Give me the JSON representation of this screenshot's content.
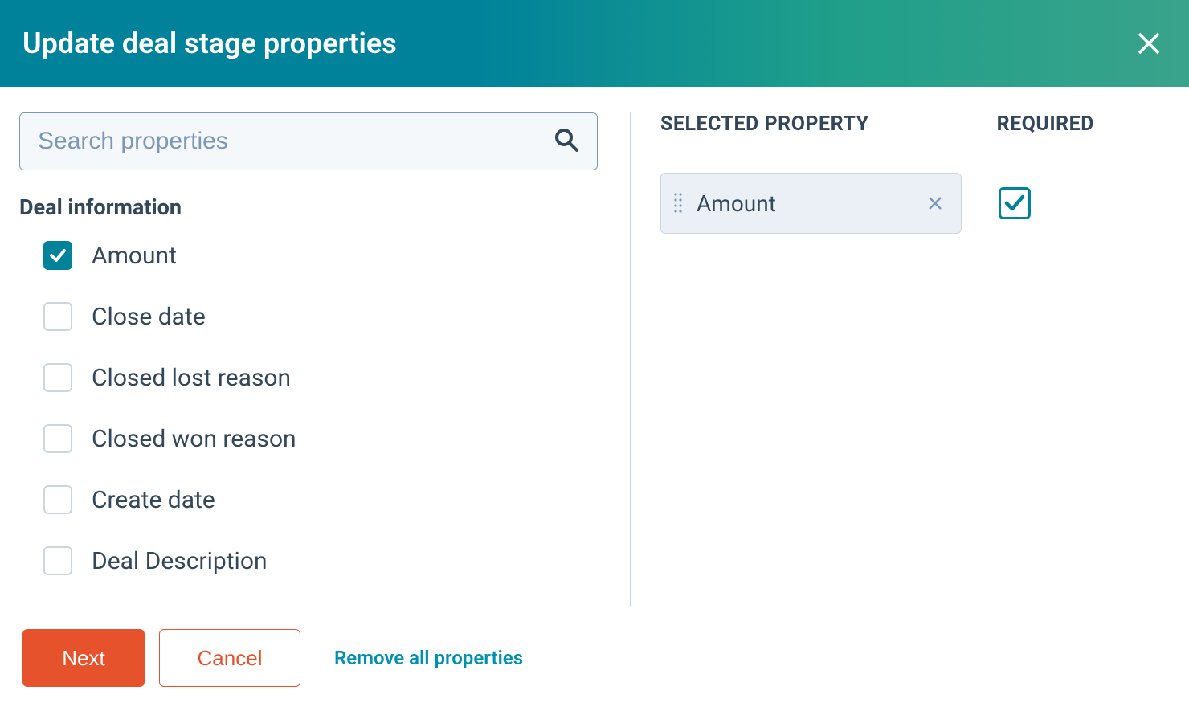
{
  "header": {
    "title": "Update deal stage properties"
  },
  "search": {
    "placeholder": "Search properties",
    "value": ""
  },
  "left": {
    "section_title": "Deal information",
    "properties": [
      {
        "label": "Amount",
        "checked": true
      },
      {
        "label": "Close date",
        "checked": false
      },
      {
        "label": "Closed lost reason",
        "checked": false
      },
      {
        "label": "Closed won reason",
        "checked": false
      },
      {
        "label": "Create date",
        "checked": false
      },
      {
        "label": "Deal Description",
        "checked": false
      }
    ]
  },
  "right": {
    "selected_heading": "SELECTED PROPERTY",
    "required_heading": "REQUIRED",
    "selected": [
      {
        "label": "Amount",
        "required": true
      }
    ]
  },
  "footer": {
    "next": "Next",
    "cancel": "Cancel",
    "remove_all": "Remove all properties"
  }
}
